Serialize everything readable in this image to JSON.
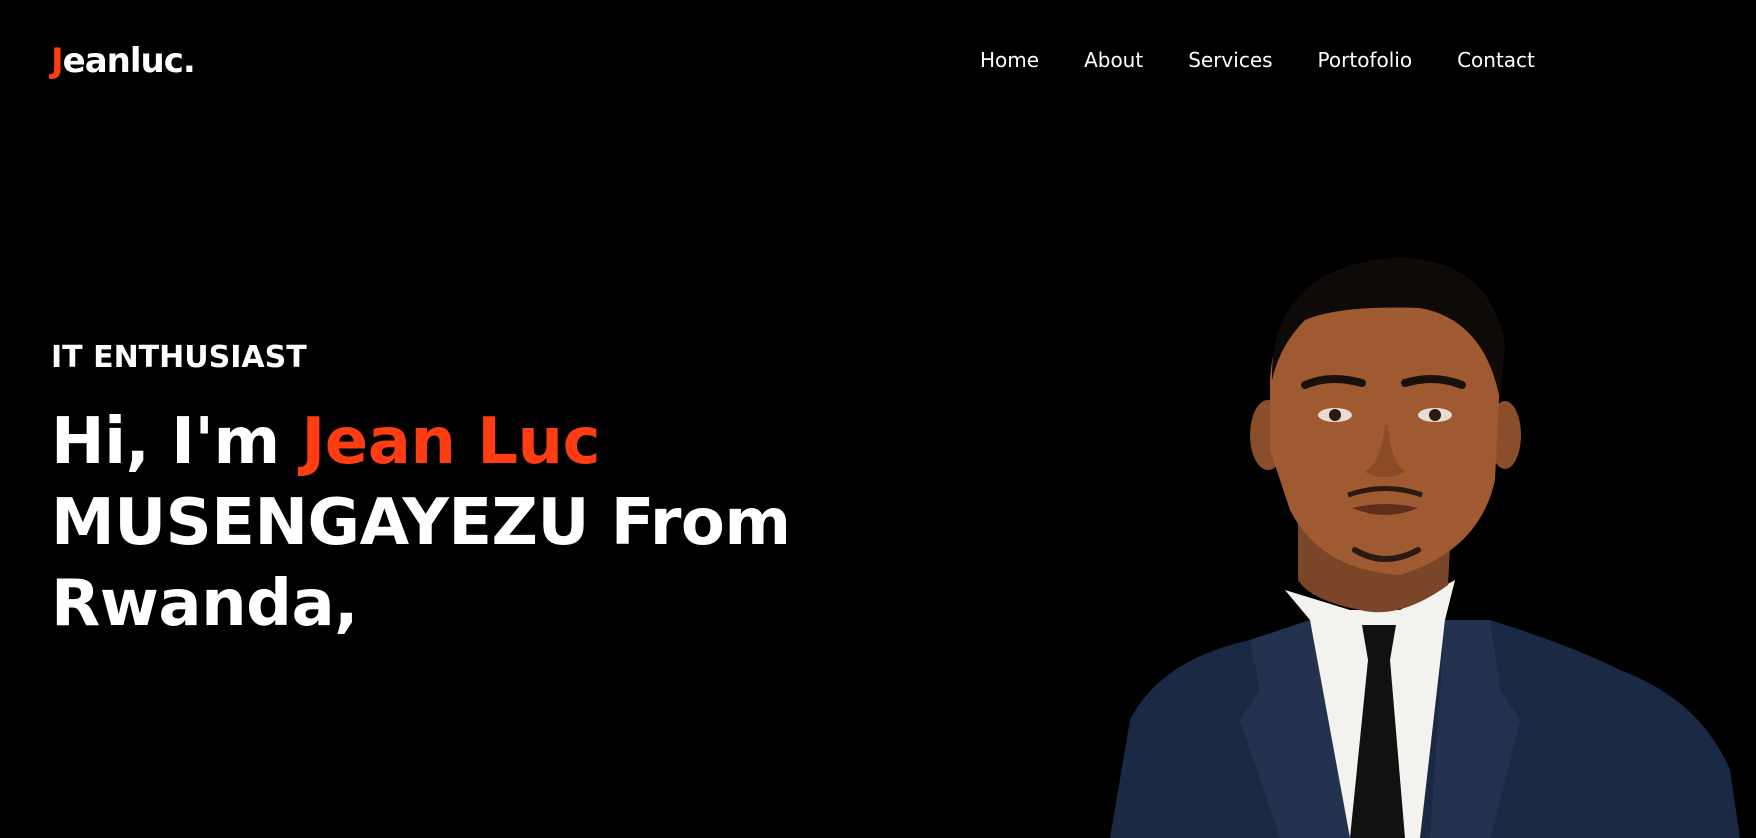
{
  "logo": {
    "first_letter": "J",
    "rest": "eanluc."
  },
  "nav": {
    "items": [
      {
        "label": "Home"
      },
      {
        "label": "About"
      },
      {
        "label": "Services"
      },
      {
        "label": "Portofolio"
      },
      {
        "label": "Contact"
      }
    ]
  },
  "hero": {
    "kicker": "IT ENTHUSIAST",
    "greeting": "Hi, I'm ",
    "name_highlight": "Jean Luc",
    "line2": "MUSENGAYEZU From",
    "line3": "Rwanda,"
  },
  "colors": {
    "accent": "#ff3c12",
    "background": "#000000",
    "text": "#ffffff"
  }
}
